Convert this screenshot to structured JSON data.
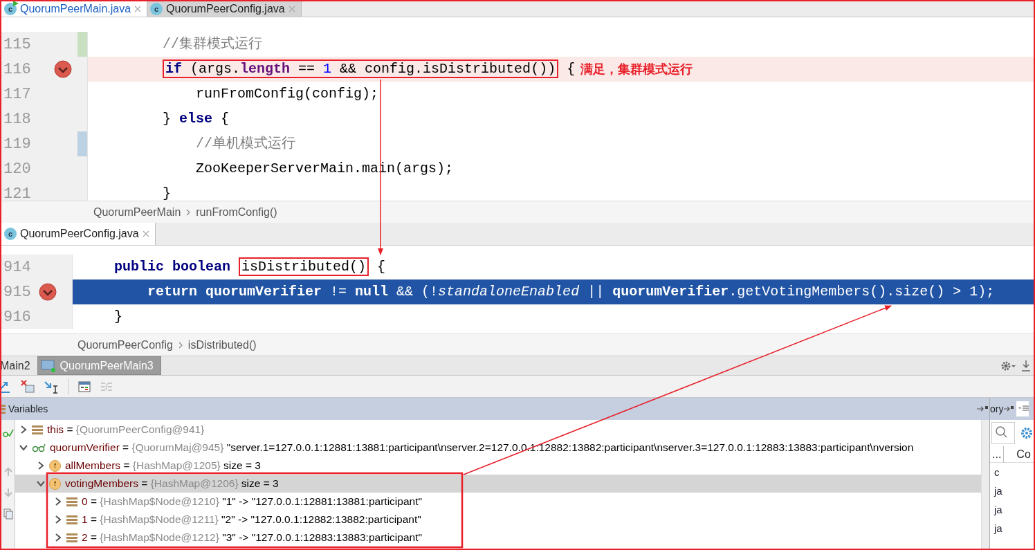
{
  "editor_tabs": [
    {
      "label": "QuorumPeerMain.java",
      "badge": "c",
      "selected": true,
      "running": true
    },
    {
      "label": "QuorumPeerConfig.java",
      "badge": "c",
      "selected": false,
      "running": false
    }
  ],
  "editor_top": {
    "lines": [
      {
        "number": "115",
        "breakpoint": false,
        "current": false,
        "color": "#c9dfc1",
        "tokens": [
          {
            "kind": "comment",
            "text": "//集群模式运行"
          }
        ]
      },
      {
        "number": "116",
        "breakpoint": true,
        "current": false,
        "note": "满足，集群模式运行",
        "tokens": [
          {
            "kind": "boxed",
            "tokens": [
              {
                "kind": "keyword",
                "text": "if"
              },
              {
                "kind": "plain",
                "text": " (args."
              },
              {
                "kind": "field",
                "text": "length"
              },
              {
                "kind": "plain",
                "text": " == "
              },
              {
                "kind": "number",
                "text": "1"
              },
              {
                "kind": "plain",
                "text": " && config.isDistributed())"
              }
            ]
          },
          {
            "kind": "plain",
            "text": " {"
          }
        ],
        "children": [
          {
            "number": "117",
            "breakpoint": false,
            "current": false,
            "tokens": [
              {
                "kind": "plain",
                "text": "runFromConfig(config);"
              }
            ]
          }
        ]
      },
      {
        "number": "118",
        "breakpoint": false,
        "current": false,
        "tokens": [
          {
            "kind": "plain",
            "text": "} "
          },
          {
            "kind": "keyword",
            "text": "else"
          },
          {
            "kind": "plain",
            "text": " {"
          }
        ],
        "children": [
          {
            "number": "119",
            "breakpoint": false,
            "current": false,
            "color": "#bcd2e4",
            "tokens": [
              {
                "kind": "comment",
                "text": "//单机模式运行"
              }
            ]
          },
          {
            "number": "120",
            "breakpoint": false,
            "current": false,
            "tokens": [
              {
                "kind": "plain",
                "text": "ZooKeeperServerMain.main(args);"
              }
            ]
          }
        ]
      },
      {
        "number": "121",
        "breakpoint": false,
        "current": false,
        "tokens": [
          {
            "kind": "plain",
            "text": "}"
          }
        ]
      }
    ],
    "breadcrumb": [
      "QuorumPeerMain",
      "runFromConfig()"
    ]
  },
  "split_tab": {
    "label": "QuorumPeerConfig.java",
    "badge": "c",
    "selected": true
  },
  "editor_bottom": {
    "lines": [
      {
        "number": "914",
        "breakpoint": false,
        "current": false,
        "tokens": [
          {
            "kind": "keyword",
            "text": "public boolean "
          },
          {
            "kind": "boxed",
            "tokens": [
              {
                "kind": "plain",
                "text": "isDistributed()"
              }
            ]
          },
          {
            "kind": "plain",
            "text": " {"
          }
        ],
        "children": [
          {
            "number": "915",
            "breakpoint": true,
            "current": true,
            "tokens": [
              {
                "kind": "keyword",
                "text": "return "
              },
              {
                "kind": "field",
                "text": "quorumVerifier"
              },
              {
                "kind": "plain",
                "text": " != "
              },
              {
                "kind": "keyword",
                "text": "null"
              },
              {
                "kind": "plain",
                "text": " && (!"
              },
              {
                "kind": "italic",
                "text": "standaloneEnabled"
              },
              {
                "kind": "plain",
                "text": " || "
              },
              {
                "kind": "field",
                "text": "quorumVerifier"
              },
              {
                "kind": "plain",
                "text": ".getVotingMembers().size() > 1);"
              }
            ]
          }
        ]
      },
      {
        "number": "916",
        "breakpoint": false,
        "current": false,
        "tokens": [
          {
            "kind": "plain",
            "text": "}"
          }
        ]
      }
    ],
    "breadcrumb": [
      "QuorumPeerConfig",
      "isDistributed()"
    ]
  },
  "debug": {
    "sessions": [
      {
        "label": "Main2",
        "selected": false
      },
      {
        "label": "QuorumPeerMain3",
        "selected": true
      }
    ],
    "variables_title": "Variables",
    "variables": [
      {
        "kind": "object",
        "name": "this",
        "separator": "=",
        "type": "{QuorumPeerConfig@941}",
        "expanded": false,
        "selected": false
      },
      {
        "kind": "watch",
        "name": "quorumVerifier",
        "separator": "=",
        "type": "{QuorumMaj@945}",
        "value": "\"server.1=127.0.0.1:12881:13881:participant\\nserver.2=127.0.0.1:12882:13882:participant\\nserver.3=127.0.0.1:12883:13883:participant\\nversion",
        "expanded": true,
        "selected": false,
        "children": [
          {
            "kind": "field",
            "badge": "f",
            "name": "allMembers",
            "separator": "=",
            "type": "{HashMap@1205}",
            "value": "size = 3",
            "expanded": false,
            "selected": false
          },
          {
            "kind": "field",
            "badge": "f",
            "name": "votingMembers",
            "separator": "=",
            "type": "{HashMap@1206}",
            "value": "size = 3",
            "expanded": true,
            "selected": true,
            "children": [
              {
                "kind": "object",
                "name": "0",
                "separator": "=",
                "type": "{HashMap$Node@1210}",
                "value": "\"1\" -> \"127.0.0.1:12881:13881:participant\"",
                "expanded": false,
                "selected": false
              },
              {
                "kind": "object",
                "name": "1",
                "separator": "=",
                "type": "{HashMap$Node@1211}",
                "value": "\"2\" -> \"127.0.0.1:12882:13882:participant\"",
                "expanded": false,
                "selected": false
              },
              {
                "kind": "object",
                "name": "2",
                "separator": "=",
                "type": "{HashMap$Node@1212}",
                "value": "\"3\" -> \"127.0.0.1:12883:13883:participant\"",
                "expanded": false,
                "selected": false
              }
            ]
          }
        ]
      }
    ],
    "side_panel": {
      "title": "ory",
      "column_1": "...",
      "column_2": "Co",
      "rows": [
        "c",
        "ja",
        "ja",
        "ja"
      ]
    }
  }
}
